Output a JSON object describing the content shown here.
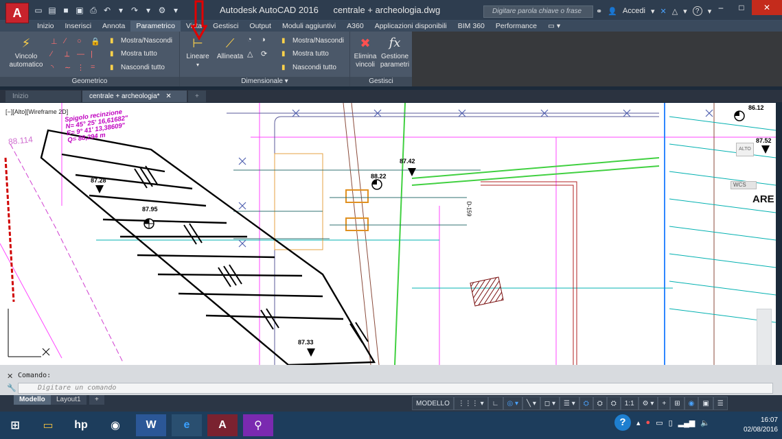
{
  "titlebar": {
    "app_letter": "A",
    "app_name": "Autodesk AutoCAD 2016",
    "file_name": "centrale + archeologia.dwg",
    "search_placeholder": "Digitare parola chiave o frase",
    "signin": "Accedi",
    "help": "?"
  },
  "ribbon_tabs": [
    "Inizio",
    "Inserisci",
    "Annota",
    "Parametrico",
    "Vista",
    "Gestisci",
    "Output",
    "Moduli aggiuntivi",
    "A360",
    "Applicazioni disponibili",
    "BIM 360",
    "Performance"
  ],
  "ribbon": {
    "geometrico": {
      "title": "Geometrico",
      "vincolo_automatico": "Vincolo automatico",
      "mostra_nascondi": "Mostra/Nascondi",
      "mostra_tutto": "Mostra tutto",
      "nascondi_tutto": "Nascondi tutto"
    },
    "dimensionale": {
      "title": "Dimensionale",
      "lineare": "Lineare",
      "allineata": "Allineata",
      "mostra_nascondi": "Mostra/Nascondi",
      "mostra_tutto": "Mostra tutto",
      "nascondi_tutto": "Nascondi tutto"
    },
    "gestisci": {
      "title": "Gestisci",
      "elimina_vincoli": "Elimina vincoli",
      "gestione_parametri": "Gestione parametri",
      "fx": "fx"
    }
  },
  "doc_tabs": [
    "Inizio",
    "centrale + archeologia*"
  ],
  "drawing": {
    "viewport_label": "[−][Alto][Wireframe 2D]",
    "annotation_lines": [
      "Spigolo recinzione",
      "N= 45° 25' 16,61682\"",
      "E= 9° 41' 13,38609\"",
      "Q= 88,294 m"
    ],
    "left_elev": "88.114",
    "elevations": [
      "87.28",
      "87.95",
      "87.33",
      "87.42",
      "88.22",
      "86.12",
      "87.52"
    ],
    "label_are": "ARE",
    "label_auto": "ALTO",
    "label_wcs": "WCS",
    "label_d159": "D-159"
  },
  "command": {
    "history": "Comando:",
    "placeholder": "Digitare un comando"
  },
  "layout_tabs": [
    "Modello",
    "Layout1",
    "+"
  ],
  "status": {
    "modello": "MODELLO",
    "scale": "1:1"
  },
  "clock": {
    "time": "16:07",
    "date": "02/08/2016"
  }
}
